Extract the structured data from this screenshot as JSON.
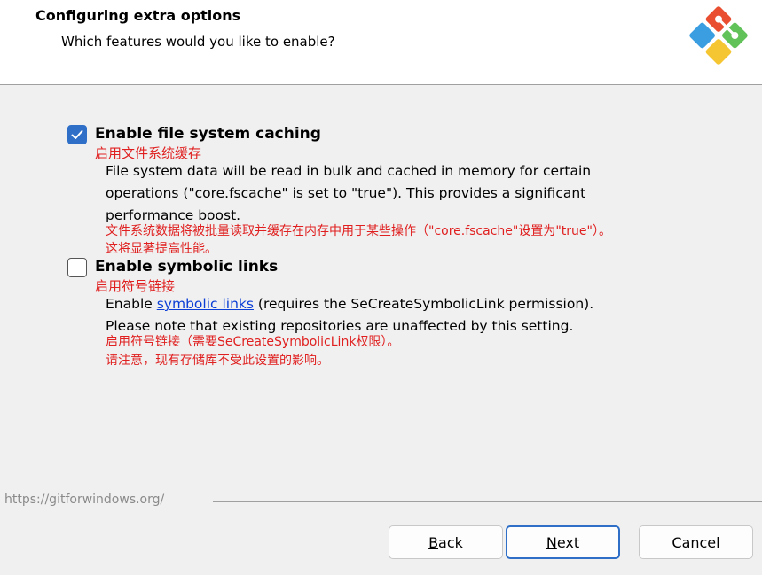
{
  "header": {
    "title": "Configuring extra options",
    "subtitle": "Which features would you like to enable?",
    "logo_icon": "git-logo-icon",
    "logo_colors": [
      "#e94e31",
      "#3b9ee0",
      "#62c25a",
      "#f5c631"
    ]
  },
  "options": [
    {
      "label": "Enable file system caching",
      "label_cn": "启用文件系统缓存",
      "checked": true,
      "desc_lines": [
        "File system data will be read in bulk and cached in memory for certain",
        "operations (\"core.fscache\" is set to \"true\"). This provides a significant",
        "performance boost."
      ],
      "desc_cn_lines": [
        "文件系统数据将被批量读取并缓存在内存中用于某些操作（\"core.fscache\"设置为\"true\"）。",
        "这将显著提高性能。"
      ]
    },
    {
      "label": "Enable symbolic links",
      "label_cn": "启用符号链接",
      "checked": false,
      "desc_prefix": "Enable ",
      "desc_link": "symbolic links",
      "desc_suffix": " (requires the SeCreateSymbolicLink permission).",
      "desc_line2": "Please note that existing repositories are unaffected by this setting.",
      "desc_cn_lines": [
        "启用符号链接（需要SeCreateSymbolicLink权限）。",
        "请注意，现有存储库不受此设置的影响。"
      ]
    }
  ],
  "footer": {
    "url": "https://gitforwindows.org/",
    "back_label": "Back",
    "back_mnemonic": "B",
    "back_rest": "ack",
    "next_label": "Next",
    "next_mnemonic": "N",
    "next_rest": "ext",
    "cancel_label": "Cancel"
  },
  "colors": {
    "accent": "#2f6fc7",
    "annotation_red": "#e02020",
    "link_blue": "#0b3fd6"
  }
}
